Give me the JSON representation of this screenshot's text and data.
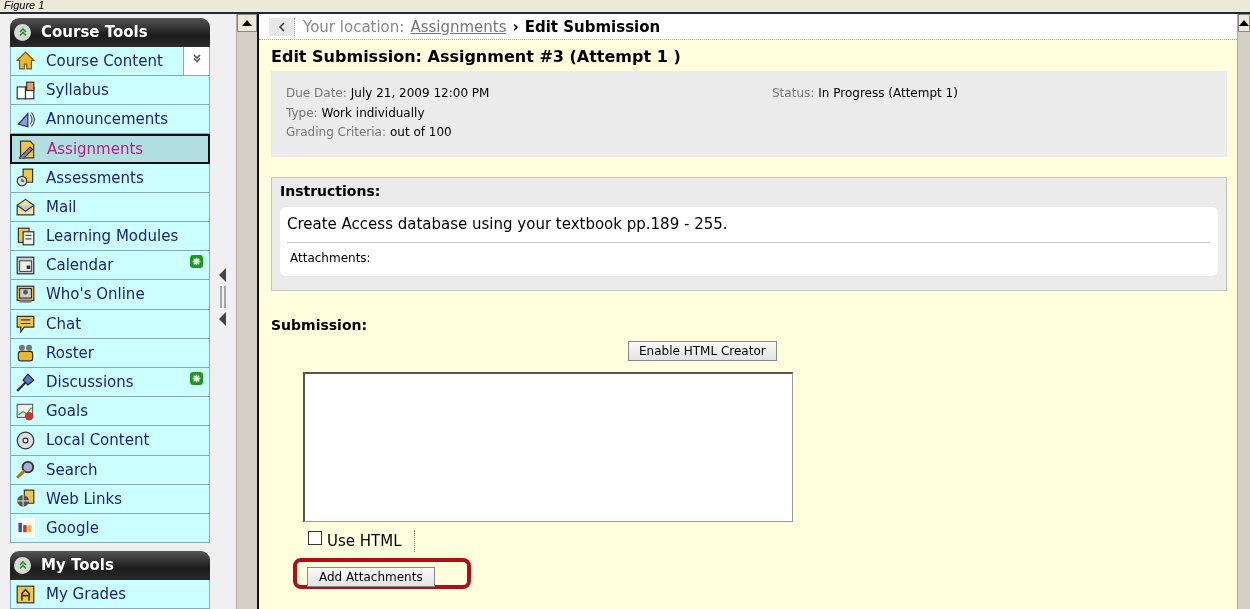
{
  "caption": "Figure 1",
  "sidebar": {
    "sections": [
      {
        "title": "Course Tools",
        "expanded": true,
        "items": [
          {
            "label": "Course Content",
            "kind": "house",
            "selected": false,
            "new": false,
            "menu": true
          },
          {
            "label": "Syllabus",
            "kind": "book",
            "selected": false,
            "new": false
          },
          {
            "label": "Announcements",
            "kind": "speaker",
            "selected": false,
            "new": false
          },
          {
            "label": "Assignments",
            "kind": "pencil",
            "selected": true,
            "new": false
          },
          {
            "label": "Assessments",
            "kind": "clock",
            "selected": false,
            "new": false
          },
          {
            "label": "Mail",
            "kind": "envelope",
            "selected": false,
            "new": false
          },
          {
            "label": "Learning Modules",
            "kind": "documents",
            "selected": false,
            "new": false
          },
          {
            "label": "Calendar",
            "kind": "calendar",
            "selected": false,
            "new": true
          },
          {
            "label": "Who's Online",
            "kind": "monitor",
            "selected": false,
            "new": false
          },
          {
            "label": "Chat",
            "kind": "bubble",
            "selected": false,
            "new": false
          },
          {
            "label": "Roster",
            "kind": "people",
            "selected": false,
            "new": false
          },
          {
            "label": "Discussions",
            "kind": "pin",
            "selected": false,
            "new": true
          },
          {
            "label": "Goals",
            "kind": "chart",
            "selected": false,
            "new": false
          },
          {
            "label": "Local Content",
            "kind": "disc",
            "selected": false,
            "new": false
          },
          {
            "label": "Search",
            "kind": "magnifier",
            "selected": false,
            "new": false
          },
          {
            "label": "Web Links",
            "kind": "globe",
            "selected": false,
            "new": false
          },
          {
            "label": "Google",
            "kind": "logo",
            "selected": false,
            "new": false
          }
        ]
      },
      {
        "title": "My Tools",
        "expanded": true,
        "items": [
          {
            "label": "My Grades",
            "kind": "grade",
            "selected": false,
            "new": false
          }
        ]
      }
    ]
  },
  "breadcrumb": {
    "prefix": "Your location:",
    "link": "Assignments",
    "separator": "›",
    "current": "Edit Submission"
  },
  "page_title": "Edit Submission: Assignment #3 (Attempt 1 )",
  "details": {
    "left": [
      {
        "label": "Due Date:",
        "value": "July 21, 2009 12:00 PM"
      },
      {
        "label": "Type:",
        "value": "Work individually"
      },
      {
        "label": "Grading Criteria:",
        "value": "out of 100"
      }
    ],
    "right": [
      {
        "label": "Status:",
        "value": "In Progress (Attempt 1)"
      }
    ]
  },
  "instructions": {
    "heading": "Instructions:",
    "text": "Create Access database using your textbook pp.189 - 255.",
    "attachments_label": "Attachments:"
  },
  "submission": {
    "heading": "Submission:",
    "html_button": "Enable HTML Creator",
    "use_html": {
      "label": "Use HTML",
      "checked": false
    },
    "attach_button": "Add Attachments",
    "attach_highlighted": true
  }
}
